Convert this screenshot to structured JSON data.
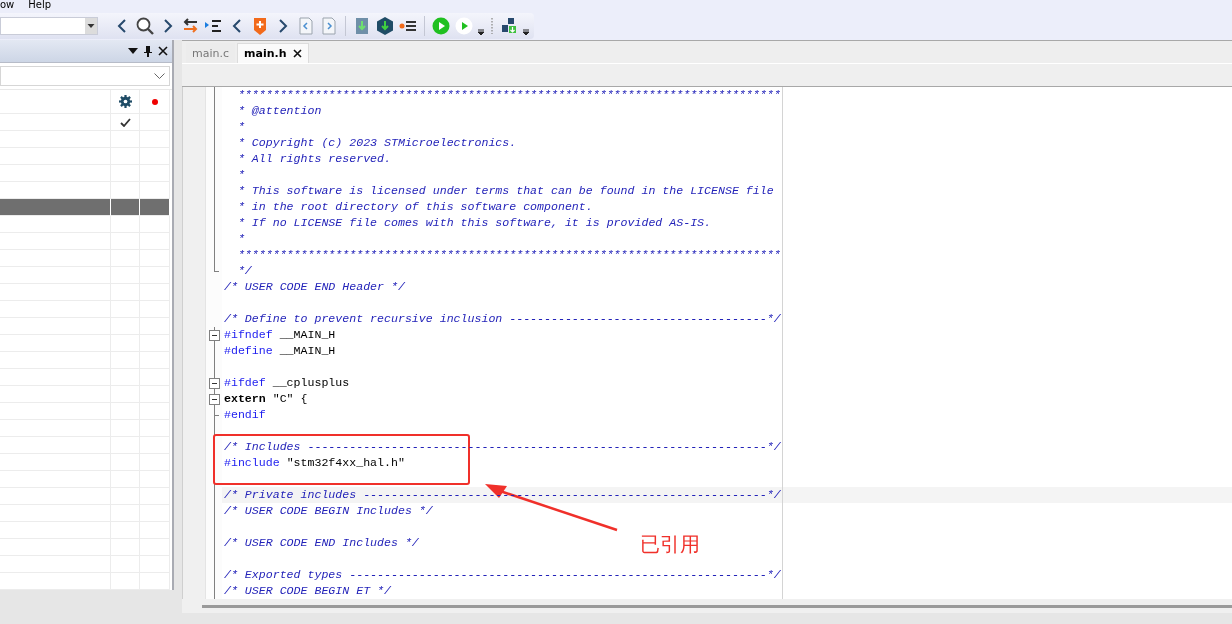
{
  "menu": [
    {
      "label": "ow"
    },
    {
      "label": "Help"
    }
  ],
  "left_panel": {
    "table": {
      "rows": [
        {
          "checked": true,
          "selected": false
        },
        {
          "checked": false,
          "selected": false
        },
        {
          "checked": false,
          "selected": false
        },
        {
          "checked": false,
          "selected": false
        },
        {
          "checked": false,
          "selected": false
        },
        {
          "checked": false,
          "selected": true
        },
        {
          "checked": false,
          "selected": false
        },
        {
          "checked": false,
          "selected": false
        },
        {
          "checked": false,
          "selected": false
        },
        {
          "checked": false,
          "selected": false
        },
        {
          "checked": false,
          "selected": false
        },
        {
          "checked": false,
          "selected": false
        },
        {
          "checked": false,
          "selected": false
        },
        {
          "checked": false,
          "selected": false
        },
        {
          "checked": false,
          "selected": false
        },
        {
          "checked": false,
          "selected": false
        },
        {
          "checked": false,
          "selected": false
        },
        {
          "checked": false,
          "selected": false
        },
        {
          "checked": false,
          "selected": false
        },
        {
          "checked": false,
          "selected": false
        },
        {
          "checked": false,
          "selected": false
        },
        {
          "checked": false,
          "selected": false
        },
        {
          "checked": false,
          "selected": false
        },
        {
          "checked": false,
          "selected": false
        },
        {
          "checked": false,
          "selected": false
        },
        {
          "checked": false,
          "selected": false
        },
        {
          "checked": false,
          "selected": false
        },
        {
          "checked": false,
          "selected": false
        }
      ]
    }
  },
  "editor": {
    "tabs": [
      {
        "label": "main.c",
        "selected": false
      },
      {
        "label": "main.h",
        "selected": true
      }
    ],
    "lines": [
      {
        "kind": "guide",
        "segments": [
          {
            "kind": "comment",
            "text": "  ******************************************************************************"
          }
        ]
      },
      {
        "kind": "guide",
        "segments": [
          {
            "kind": "comment",
            "text": "  * @attention"
          }
        ]
      },
      {
        "kind": "guide",
        "segments": [
          {
            "kind": "comment",
            "text": "  *"
          }
        ]
      },
      {
        "kind": "guide",
        "segments": [
          {
            "kind": "comment",
            "text": "  * Copyright (c) 2023 STMicroelectronics."
          }
        ]
      },
      {
        "kind": "guide",
        "segments": [
          {
            "kind": "comment",
            "text": "  * All rights reserved."
          }
        ]
      },
      {
        "kind": "guide",
        "segments": [
          {
            "kind": "comment",
            "text": "  *"
          }
        ]
      },
      {
        "kind": "guide",
        "segments": [
          {
            "kind": "comment",
            "text": "  * This software is licensed under terms that can be found in the LICENSE file"
          }
        ]
      },
      {
        "kind": "guide",
        "segments": [
          {
            "kind": "comment",
            "text": "  * in the root directory of this software component."
          }
        ]
      },
      {
        "kind": "guide",
        "segments": [
          {
            "kind": "comment",
            "text": "  * If no LICENSE file comes with this software, it is provided AS-IS."
          }
        ]
      },
      {
        "kind": "guide",
        "segments": [
          {
            "kind": "comment",
            "text": "  *"
          }
        ]
      },
      {
        "kind": "guide",
        "segments": [
          {
            "kind": "comment",
            "text": "  ******************************************************************************"
          }
        ]
      },
      {
        "kind": "corner",
        "segments": [
          {
            "kind": "comment",
            "text": "  */"
          }
        ]
      },
      {
        "kind": "plain",
        "segments": [
          {
            "kind": "comment",
            "text": "/* USER CODE END Header */"
          }
        ]
      },
      {
        "kind": "plain"
      },
      {
        "kind": "plain",
        "segments": [
          {
            "kind": "comment",
            "text": "/* Define to prevent recursive inclusion -------------------------------------*/"
          }
        ]
      },
      {
        "kind": "box",
        "segments": [
          {
            "kind": "directive",
            "text": "#ifndef"
          },
          {
            "kind": "plain",
            "text": " __MAIN_H"
          }
        ]
      },
      {
        "kind": "guide",
        "segments": [
          {
            "kind": "directive",
            "text": "#define"
          },
          {
            "kind": "plain",
            "text": " __MAIN_H"
          }
        ]
      },
      {
        "kind": "guide"
      },
      {
        "kind": "box",
        "segments": [
          {
            "kind": "directive",
            "text": "#ifdef"
          },
          {
            "kind": "plain",
            "text": " __cplusplus"
          }
        ]
      },
      {
        "kind": "box",
        "segments": [
          {
            "kind": "keyword",
            "text": "extern"
          },
          {
            "kind": "plain",
            "text": " \"C\" {"
          }
        ]
      },
      {
        "kind": "tee",
        "segments": [
          {
            "kind": "directive",
            "text": "#endif"
          }
        ]
      },
      {
        "kind": "guide"
      },
      {
        "kind": "guide",
        "highlighted": true,
        "segments": [
          {
            "kind": "comment",
            "text": "/* Includes ------------------------------------------------------------------*/"
          }
        ]
      },
      {
        "kind": "guide",
        "highlighted": true,
        "segments": [
          {
            "kind": "directive",
            "text": "#include"
          },
          {
            "kind": "plain",
            "text": " \"stm32f4xx_hal.h\""
          }
        ]
      },
      {
        "kind": "guide",
        "highlighted": true
      },
      {
        "kind": "guide",
        "current": true,
        "segments": [
          {
            "kind": "comment",
            "text": "/* Private includes ----------------------------------------------------------*/"
          }
        ]
      },
      {
        "kind": "guide",
        "segments": [
          {
            "kind": "comment",
            "text": "/* USER CODE BEGIN Includes */"
          }
        ]
      },
      {
        "kind": "guide"
      },
      {
        "kind": "guide",
        "segments": [
          {
            "kind": "comment",
            "text": "/* USER CODE END Includes */"
          }
        ]
      },
      {
        "kind": "guide"
      },
      {
        "kind": "guide",
        "segments": [
          {
            "kind": "comment",
            "text": "/* Exported types ------------------------------------------------------------*/"
          }
        ]
      },
      {
        "kind": "guide",
        "segments": [
          {
            "kind": "comment",
            "text": "/* USER CODE BEGIN ET */"
          }
        ]
      }
    ],
    "annotation": {
      "label": "已引用"
    }
  }
}
